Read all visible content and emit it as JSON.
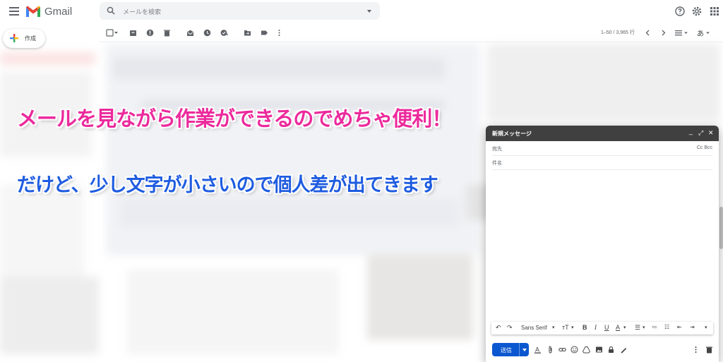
{
  "header": {
    "app_name": "Gmail",
    "search_placeholder": "メールを検索"
  },
  "sidebar": {
    "compose_label": "作成"
  },
  "toolbar": {
    "pager_text": "1–50 / 3,965 行",
    "input_tool_label": "あ"
  },
  "captions": {
    "line1": "メールを見ながら作業ができるのでめちゃ便利！",
    "line2": "だけど、少し文字が小さいので個人差が出てきます"
  },
  "compose_window": {
    "title": "新規メッセージ",
    "to_label": "宛先",
    "cc_bcc_label": "Cc Bcc",
    "subject_label": "件名",
    "font_name": "Sans Serif",
    "send_label": "送信"
  },
  "colors": {
    "caption1": "#ec2a9c",
    "caption2": "#1f5ce0",
    "send_button": "#0b57d0",
    "compose_title_bar": "#404040"
  }
}
